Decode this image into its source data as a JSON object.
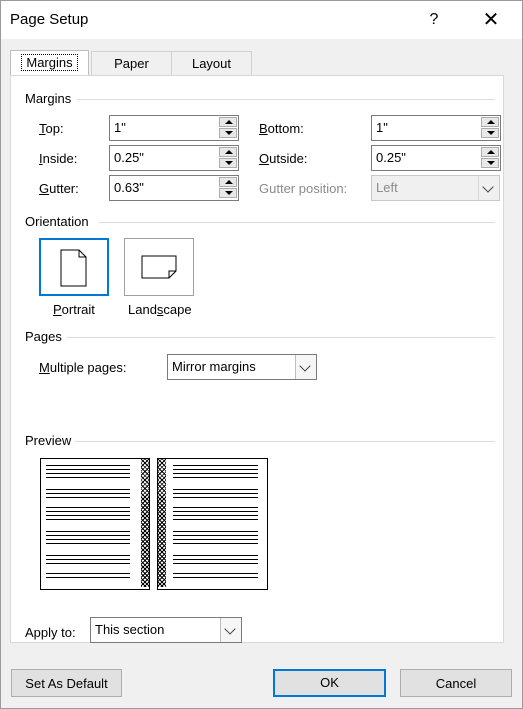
{
  "window": {
    "title": "Page Setup",
    "help_glyph": "?",
    "close_glyph": "✕"
  },
  "tabs": [
    {
      "label": "Margins",
      "active": true
    },
    {
      "label": "Paper",
      "active": false
    },
    {
      "label": "Layout",
      "active": false
    }
  ],
  "margins": {
    "section_title": "Margins",
    "top": {
      "label_first": "T",
      "label_rest": "op:",
      "value": "1\""
    },
    "bottom": {
      "label_first": "B",
      "label_rest": "ottom:",
      "value": "1\""
    },
    "inside": {
      "label_first": "I",
      "label_rest": "nside:",
      "value": "0.25\""
    },
    "outside": {
      "label_first": "O",
      "label_rest": "utside:",
      "value": "0.25\""
    },
    "gutter": {
      "label_first": "G",
      "label_rest": "utter:",
      "value": "0.63\""
    },
    "gutter_position": {
      "label": "Gutter position:",
      "value": "Left",
      "enabled": false
    }
  },
  "orientation": {
    "section_title": "Orientation",
    "portrait": {
      "label_first": "P",
      "label_rest": "ortrait",
      "selected": true
    },
    "landscape": {
      "label_pre": "Land",
      "label_key": "s",
      "label_rest": "cape",
      "selected": false
    }
  },
  "pages": {
    "section_title": "Pages",
    "multiple_pages": {
      "label_first": "M",
      "label_rest": "ultiple pages:",
      "value": "Mirror margins"
    }
  },
  "preview": {
    "section_title": "Preview"
  },
  "apply_to": {
    "label": "Apply to:",
    "value": "This section"
  },
  "buttons": {
    "set_default": "Set As Default",
    "ok": "OK",
    "cancel": "Cancel"
  },
  "colors": {
    "accent": "#0078d7",
    "dialog_bg": "#f0f0f0"
  }
}
